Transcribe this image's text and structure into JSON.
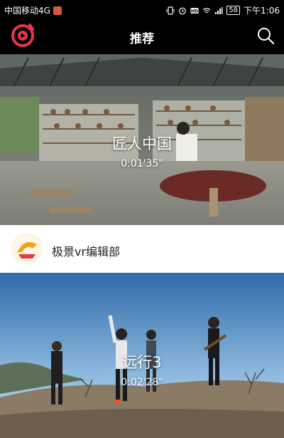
{
  "status_bar": {
    "carrier": "中国移动4G",
    "battery": "58",
    "time": "下午1:06"
  },
  "header": {
    "title": "推荐",
    "logo_icon": "play-logo-icon",
    "search_icon": "search-icon"
  },
  "videos": [
    {
      "title": "匠人中国",
      "duration": "0:01'35\""
    },
    {
      "title": "远行3",
      "duration": "0:02'28\""
    }
  ],
  "channel": {
    "name": "极景vr编辑部"
  },
  "colors": {
    "accent": "#e8334a",
    "header_bg": "#000000"
  }
}
